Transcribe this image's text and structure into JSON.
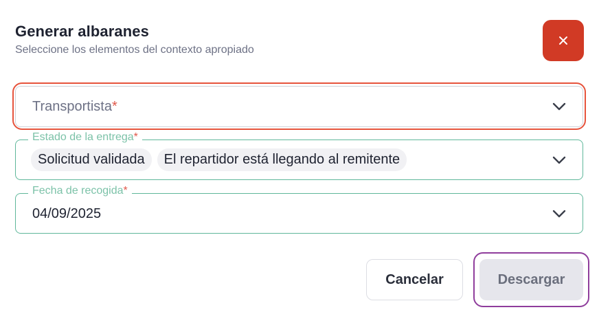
{
  "dialog": {
    "title": "Generar albaranes",
    "subtitle": "Seleccione los elementos del contexto apropiado",
    "close_icon": "close-icon"
  },
  "fields": {
    "transportista": {
      "placeholder": "Transportista",
      "required_mark": "*"
    },
    "estado": {
      "label": "Estado de la entrega",
      "required_mark": "*",
      "chips": [
        "Solicitud validada",
        "El repartidor está llegando al remitente"
      ]
    },
    "fecha": {
      "label": "Fecha de recogida",
      "required_mark": "*",
      "value": "04/09/2025"
    }
  },
  "actions": {
    "cancel_label": "Cancelar",
    "download_label": "Descargar"
  },
  "colors": {
    "close_bg": "#d13a25",
    "focus_ring": "#e6533c",
    "field_border_active": "#5fb79a",
    "download_ring": "#8f3d9c"
  }
}
